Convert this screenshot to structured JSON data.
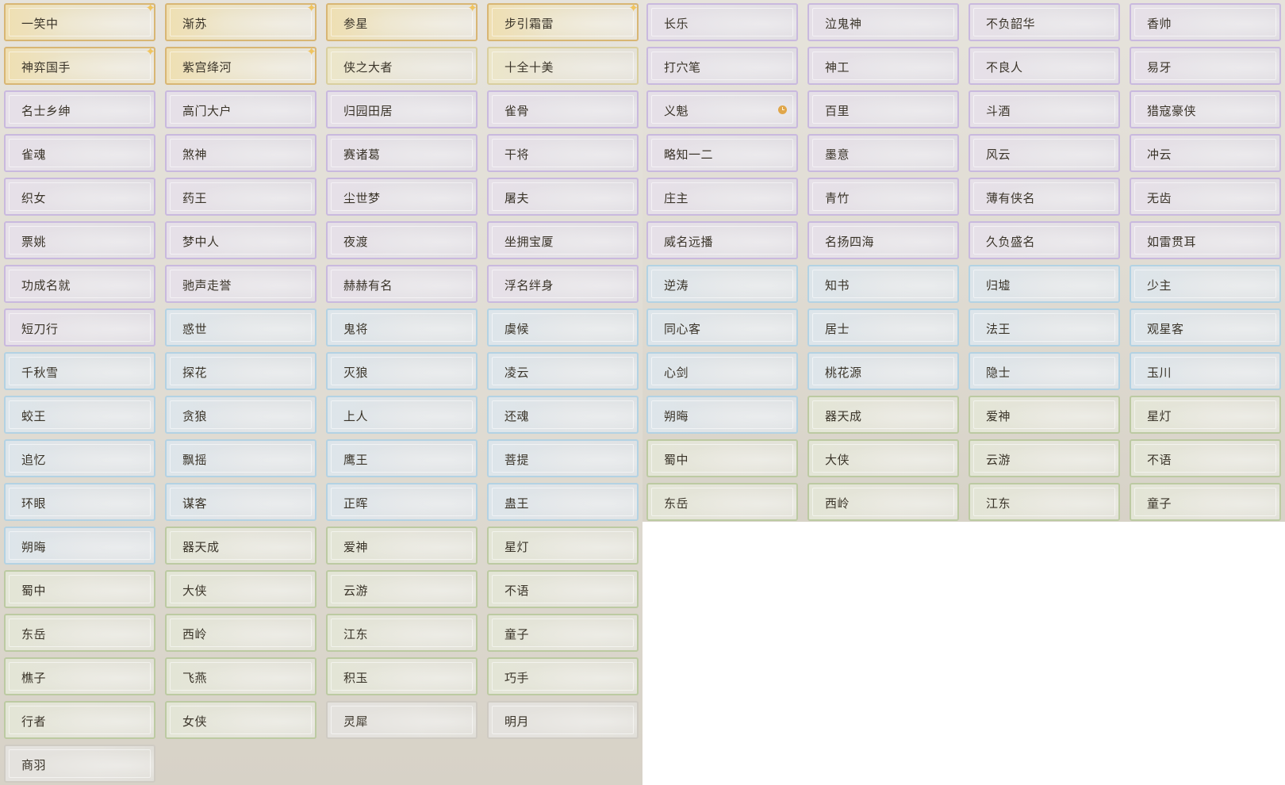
{
  "titles_left": [
    {
      "label": "一笑中",
      "tier": "gold",
      "marker": "sparkle"
    },
    {
      "label": "渐苏",
      "tier": "gold",
      "marker": "sparkle"
    },
    {
      "label": "参星",
      "tier": "gold",
      "marker": "sparkle"
    },
    {
      "label": "步引霜雷",
      "tier": "gold",
      "marker": "sparkle"
    },
    {
      "label": "神弈国手",
      "tier": "gold",
      "marker": "sparkle"
    },
    {
      "label": "紫宫绛河",
      "tier": "gold",
      "marker": "sparkle"
    },
    {
      "label": "侠之大者",
      "tier": "beige"
    },
    {
      "label": "十全十美",
      "tier": "beige"
    },
    {
      "label": "名士乡绅",
      "tier": "purple"
    },
    {
      "label": "高门大户",
      "tier": "purple"
    },
    {
      "label": "归园田居",
      "tier": "purple"
    },
    {
      "label": "雀骨",
      "tier": "purple"
    },
    {
      "label": "雀魂",
      "tier": "purple"
    },
    {
      "label": "煞神",
      "tier": "purple"
    },
    {
      "label": "赛诸葛",
      "tier": "purple"
    },
    {
      "label": "干将",
      "tier": "purple"
    },
    {
      "label": "织女",
      "tier": "purple"
    },
    {
      "label": "药王",
      "tier": "purple"
    },
    {
      "label": "尘世梦",
      "tier": "purple"
    },
    {
      "label": "屠夫",
      "tier": "purple"
    },
    {
      "label": "票姚",
      "tier": "purple"
    },
    {
      "label": "梦中人",
      "tier": "purple"
    },
    {
      "label": "夜渡",
      "tier": "purple"
    },
    {
      "label": "坐拥宝厦",
      "tier": "purple"
    },
    {
      "label": "功成名就",
      "tier": "purple"
    },
    {
      "label": "驰声走誉",
      "tier": "purple"
    },
    {
      "label": "赫赫有名",
      "tier": "purple"
    },
    {
      "label": "浮名绊身",
      "tier": "purple"
    },
    {
      "label": "短刀行",
      "tier": "purple"
    },
    {
      "label": "惑世",
      "tier": "blue"
    },
    {
      "label": "鬼将",
      "tier": "blue"
    },
    {
      "label": "虞候",
      "tier": "blue"
    },
    {
      "label": "千秋雪",
      "tier": "blue"
    },
    {
      "label": "探花",
      "tier": "blue"
    },
    {
      "label": "灭狼",
      "tier": "blue"
    },
    {
      "label": "凌云",
      "tier": "blue"
    },
    {
      "label": "蛟王",
      "tier": "blue"
    },
    {
      "label": "贪狼",
      "tier": "blue"
    },
    {
      "label": "上人",
      "tier": "blue"
    },
    {
      "label": "还魂",
      "tier": "blue"
    },
    {
      "label": "追忆",
      "tier": "blue"
    },
    {
      "label": "飘摇",
      "tier": "blue"
    },
    {
      "label": "鹰王",
      "tier": "blue"
    },
    {
      "label": "菩提",
      "tier": "blue"
    },
    {
      "label": "环眼",
      "tier": "blue"
    },
    {
      "label": "谋客",
      "tier": "blue"
    },
    {
      "label": "正晖",
      "tier": "blue"
    },
    {
      "label": "蛊王",
      "tier": "blue"
    },
    {
      "label": "朔晦",
      "tier": "blue"
    },
    {
      "label": "器天成",
      "tier": "green"
    },
    {
      "label": "爱神",
      "tier": "green"
    },
    {
      "label": "星灯",
      "tier": "green"
    },
    {
      "label": "蜀中",
      "tier": "green"
    },
    {
      "label": "大侠",
      "tier": "green"
    },
    {
      "label": "云游",
      "tier": "green"
    },
    {
      "label": "不语",
      "tier": "green"
    },
    {
      "label": "东岳",
      "tier": "green"
    },
    {
      "label": "西岭",
      "tier": "green"
    },
    {
      "label": "江东",
      "tier": "green"
    },
    {
      "label": "童子",
      "tier": "green"
    },
    {
      "label": "樵子",
      "tier": "green"
    },
    {
      "label": "飞燕",
      "tier": "green"
    },
    {
      "label": "积玉",
      "tier": "green"
    },
    {
      "label": "巧手",
      "tier": "green"
    },
    {
      "label": "行者",
      "tier": "green"
    },
    {
      "label": "女侠",
      "tier": "green"
    },
    {
      "label": "灵犀",
      "tier": "grey"
    },
    {
      "label": "明月",
      "tier": "grey"
    },
    {
      "label": "商羽",
      "tier": "grey"
    }
  ],
  "titles_right": [
    {
      "label": "长乐",
      "tier": "purple"
    },
    {
      "label": "泣鬼神",
      "tier": "purple"
    },
    {
      "label": "不负韶华",
      "tier": "purple"
    },
    {
      "label": "香帅",
      "tier": "purple"
    },
    {
      "label": "打穴笔",
      "tier": "purple"
    },
    {
      "label": "神工",
      "tier": "purple"
    },
    {
      "label": "不良人",
      "tier": "purple"
    },
    {
      "label": "易牙",
      "tier": "purple"
    },
    {
      "label": "义魁",
      "tier": "purple",
      "marker": "clock"
    },
    {
      "label": "百里",
      "tier": "purple"
    },
    {
      "label": "斗酒",
      "tier": "purple"
    },
    {
      "label": "猎寇豪侠",
      "tier": "purple"
    },
    {
      "label": "略知一二",
      "tier": "purple"
    },
    {
      "label": "墨意",
      "tier": "purple"
    },
    {
      "label": "风云",
      "tier": "purple"
    },
    {
      "label": "冲云",
      "tier": "purple"
    },
    {
      "label": "庄主",
      "tier": "purple"
    },
    {
      "label": "青竹",
      "tier": "purple"
    },
    {
      "label": "薄有侠名",
      "tier": "purple"
    },
    {
      "label": "无齿",
      "tier": "purple"
    },
    {
      "label": "威名远播",
      "tier": "purple"
    },
    {
      "label": "名扬四海",
      "tier": "purple"
    },
    {
      "label": "久负盛名",
      "tier": "purple"
    },
    {
      "label": "如雷贯耳",
      "tier": "purple"
    },
    {
      "label": "逆涛",
      "tier": "blue"
    },
    {
      "label": "知书",
      "tier": "blue"
    },
    {
      "label": "归墟",
      "tier": "blue"
    },
    {
      "label": "少主",
      "tier": "blue"
    },
    {
      "label": "同心客",
      "tier": "blue"
    },
    {
      "label": "居士",
      "tier": "blue"
    },
    {
      "label": "法王",
      "tier": "blue"
    },
    {
      "label": "观星客",
      "tier": "blue"
    },
    {
      "label": "心剑",
      "tier": "blue"
    },
    {
      "label": "桃花源",
      "tier": "blue"
    },
    {
      "label": "隐士",
      "tier": "blue"
    },
    {
      "label": "玉川",
      "tier": "blue"
    },
    {
      "label": "朔晦",
      "tier": "blue"
    },
    {
      "label": "器天成",
      "tier": "green"
    },
    {
      "label": "爱神",
      "tier": "green"
    },
    {
      "label": "星灯",
      "tier": "green"
    },
    {
      "label": "蜀中",
      "tier": "green"
    },
    {
      "label": "大侠",
      "tier": "green"
    },
    {
      "label": "云游",
      "tier": "green"
    },
    {
      "label": "不语",
      "tier": "green"
    },
    {
      "label": "东岳",
      "tier": "green"
    },
    {
      "label": "西岭",
      "tier": "green"
    },
    {
      "label": "江东",
      "tier": "green"
    },
    {
      "label": "童子",
      "tier": "green"
    }
  ],
  "markers": {
    "sparkle": "✦"
  },
  "colors": {
    "gold": "#d8b674",
    "beige": "#d9cf9f",
    "purple": "#c9b9de",
    "blue": "#b3d2e3",
    "green": "#bccaa2",
    "grey": "#cfcbc3",
    "label_text": "#3a3429"
  }
}
